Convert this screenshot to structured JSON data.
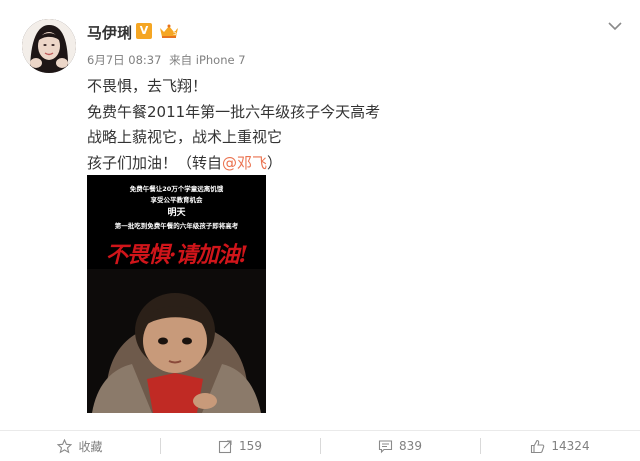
{
  "user": {
    "name": "马伊琍",
    "verified_badge": "V",
    "member_icon": "vip-crown-icon"
  },
  "meta": {
    "date": "6月7日 08:37",
    "source": "来自 iPhone 7"
  },
  "post": {
    "lines": [
      "不畏惧，去飞翔！",
      "免费午餐2011年第一批六年级孩子今天高考",
      "战略上藐视它，战术上重视它"
    ],
    "last_line_prefix": "孩子们加油！（转自",
    "mention": "@邓飞",
    "last_line_suffix": "）"
  },
  "image": {
    "line1": "免费午餐让20万个学童远离饥饿",
    "line2": "享受公平教育机会",
    "line3": "明天",
    "line4": "第一批吃到免费午餐的六年级孩子即将高考",
    "slogan": "不畏惧·请加油!"
  },
  "actions": {
    "favorite_label": "收藏",
    "repost_count": "159",
    "comment_count": "839",
    "like_count": "14324"
  },
  "colors": {
    "mention": "#eb7350",
    "badge": "#f5a623",
    "slogan": "#d0151a"
  }
}
